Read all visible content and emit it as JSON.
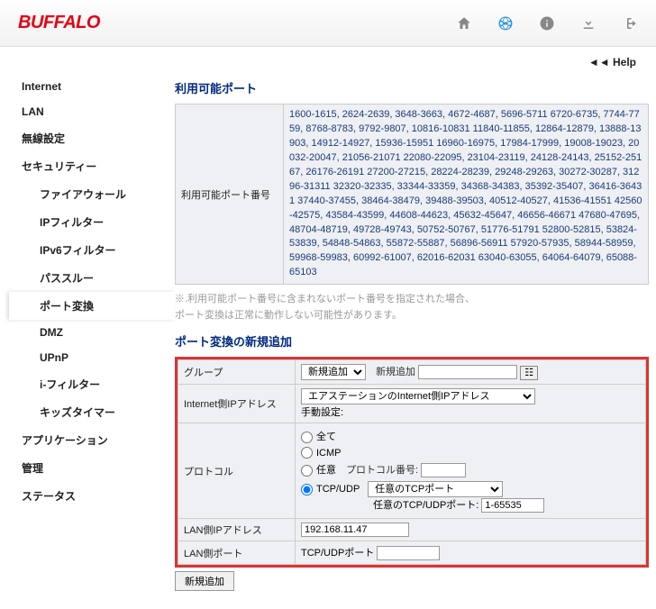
{
  "brand": "BUFFALO",
  "help": "◄◄ Help",
  "sidebar": {
    "items": [
      "Internet",
      "LAN",
      "無線設定",
      "セキュリティー"
    ],
    "subs": [
      "ファイアウォール",
      "IPフィルター",
      "IPv6フィルター",
      "パススルー",
      "ポート変換",
      "DMZ",
      "UPnP",
      "i-フィルター",
      "キッズタイマー"
    ],
    "items2": [
      "アプリケーション",
      "管理",
      "ステータス"
    ]
  },
  "ports_title": "利用可能ポート",
  "ports_header": "利用可能ポート番号",
  "ports_ranges": "1600-1615, 2624-2639, 3648-3663, 4672-4687, 5696-5711 6720-6735, 7744-7759, 8768-8783, 9792-9807, 10816-10831 11840-11855, 12864-12879, 13888-13903, 14912-14927, 15936-15951 16960-16975, 17984-17999, 19008-19023, 20032-20047, 21056-21071 22080-22095, 23104-23119, 24128-24143, 25152-25167, 26176-26191 27200-27215, 28224-28239, 29248-29263, 30272-30287, 31296-31311 32320-32335, 33344-33359, 34368-34383, 35392-35407, 36416-36431 37440-37455, 38464-38479, 39488-39503, 40512-40527, 41536-41551 42560-42575, 43584-43599, 44608-44623, 45632-45647, 46656-46671 47680-47695, 48704-48719, 49728-49743, 50752-50767, 51776-51791 52800-52815, 53824-53839, 54848-54863, 55872-55887, 56896-56911 57920-57935, 58944-58959, 59968-59983, 60992-61007, 62016-62031 63040-63055, 64064-64079, 65088-65103",
  "note1": "※.利用可能ポート番号に含まれないポート番号を指定された場合、",
  "note2": "ポート変換は正常に動作しない可能性があります。",
  "form_title": "ポート変換の新規追加",
  "form": {
    "group": "グループ",
    "group_opt": "新規追加",
    "group_new": "新規追加",
    "wan_ip_label": "Internet側IPアドレス",
    "wan_ip_opt": "エアステーションのInternet側IPアドレス",
    "wan_ip_manual": "手動設定:",
    "proto_label": "プロトコル",
    "proto_all": "全て",
    "proto_icmp": "ICMP",
    "proto_any": "任意",
    "proto_any_num": "プロトコル番号:",
    "proto_tcpudp": "TCP/UDP",
    "proto_tcp_sel": "任意のTCPポート",
    "proto_tcp_range_lbl": "任意のTCP/UDPポート:",
    "proto_tcp_range_val": "1-65535",
    "lan_ip_label": "LAN側IPアドレス",
    "lan_ip_val": "192.168.11.47",
    "lan_port_label": "LAN側ポート",
    "lan_port_prefix": "TCP/UDPポート",
    "submit": "新規追加"
  }
}
